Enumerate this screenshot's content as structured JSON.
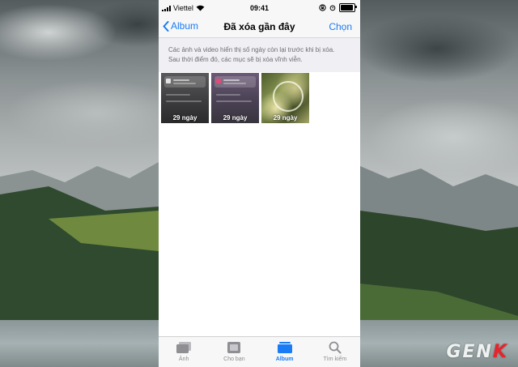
{
  "status_bar": {
    "carrier": "Viettel",
    "time": "09:41",
    "battery_level": 0.95
  },
  "nav": {
    "back_label": "Album",
    "title": "Đã xóa gần đây",
    "select_label": "Chọn"
  },
  "info": {
    "line1": "Các ảnh và video hiển thị số ngày còn lại trước khi bị xóa.",
    "line2": "Sau thời điểm đó, các mục sẽ bị xóa vĩnh viễn."
  },
  "items": [
    {
      "label": "29 ngày",
      "style": "dark"
    },
    {
      "label": "29 ngày",
      "style": "purple"
    },
    {
      "label": "29 ngày",
      "style": "photo"
    }
  ],
  "tabs": [
    {
      "label": "Ảnh",
      "icon": "photos-icon",
      "active": false
    },
    {
      "label": "Cho bạn",
      "icon": "for-you-icon",
      "active": false
    },
    {
      "label": "Album",
      "icon": "albums-icon",
      "active": true
    },
    {
      "label": "Tìm kiếm",
      "icon": "search-icon",
      "active": false
    }
  ],
  "watermark": {
    "text_a": "GEN",
    "text_b": "K"
  },
  "colors": {
    "accent": "#1a7cf5",
    "tab_inactive": "#8e8e93"
  }
}
